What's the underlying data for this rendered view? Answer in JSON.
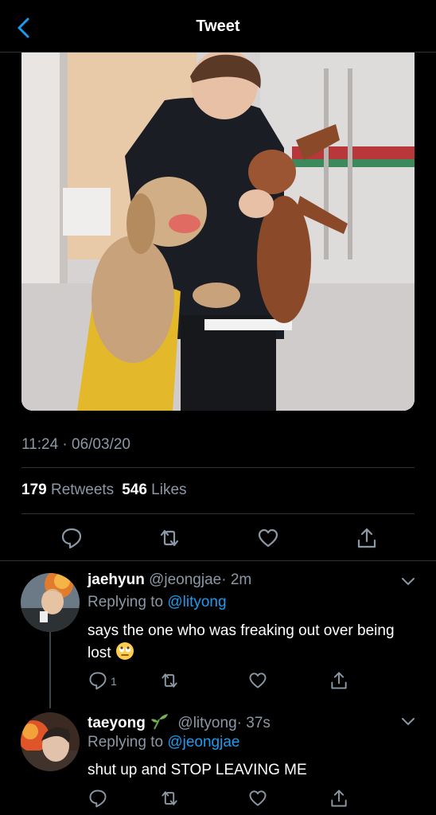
{
  "header": {
    "title": "Tweet"
  },
  "tweet": {
    "timestamp": "11:24 · 06/03/20",
    "retweets_count": "179",
    "retweets_label": "Retweets",
    "likes_count": "546",
    "likes_label": "Likes"
  },
  "replies": [
    {
      "name": "jaehyun",
      "handle": "@jeongjae",
      "time": "· 2m",
      "replying_prefix": "Replying to",
      "replying_to": "@lityong",
      "text": "says the one who was freaking out over being lost",
      "reply_count": "1"
    },
    {
      "name": "taeyong",
      "handle": "@lityong",
      "time": "· 37s",
      "replying_prefix": "Replying to",
      "replying_to": "@jeongjae",
      "text": "shut up and STOP LEAVING ME"
    }
  ],
  "colors": {
    "accent": "#1d9bf0",
    "muted": "#8b98a5",
    "background": "#000000",
    "divider": "#2f3336"
  },
  "icons": [
    "back-chevron-icon",
    "reply-icon",
    "retweet-icon",
    "like-icon",
    "share-icon",
    "chevron-down-icon",
    "plant-emoji-icon",
    "eye-roll-emoji-icon"
  ]
}
